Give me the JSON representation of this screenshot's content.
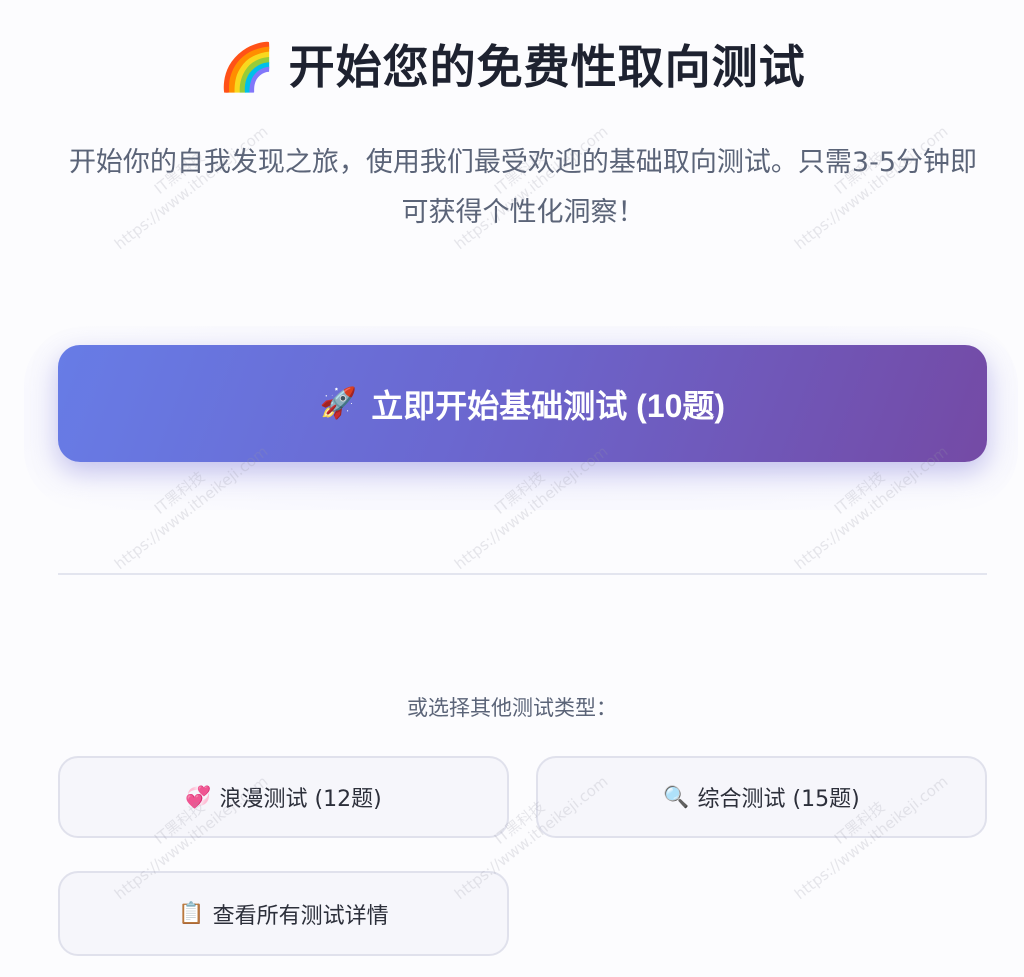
{
  "header": {
    "title_emoji": "🌈",
    "title": "开始您的免费性取向测试",
    "subtitle": "开始你的自我发现之旅，使用我们最受欢迎的基础取向测试。只需3-5分钟即可获得个性化洞察！"
  },
  "primary_action": {
    "emoji": "🚀",
    "label": "立即开始基础测试 (10题)"
  },
  "other_section": {
    "label": "或选择其他测试类型："
  },
  "options": [
    {
      "emoji": "💞",
      "label": "浪漫测试 (12题)"
    },
    {
      "emoji": "🔍",
      "label": "综合测试 (15题)"
    },
    {
      "emoji": "📋",
      "label": "查看所有测试详情"
    }
  ],
  "watermark": {
    "brand": "IT黑科技",
    "url": "https://www.itheikeji.com"
  },
  "colors": {
    "accent_start": "#677ce6",
    "accent_end": "#744aa5",
    "title": "#1e2230",
    "muted_text": "#5b6478"
  }
}
